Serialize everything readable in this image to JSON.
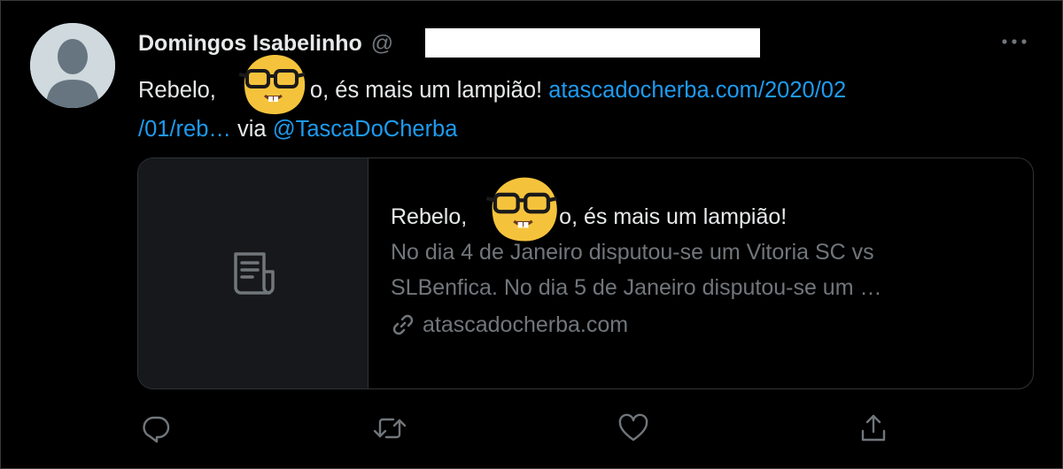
{
  "tweet": {
    "author_name": "Domingos Isabelinho",
    "handle_prefix": "@",
    "text_line1_a": "Rebelo,",
    "text_line1_b": "o, és mais um lampião!",
    "link_line1": "atascadocherba.com/2020/02",
    "link_line2": "/01/reb…",
    "via_text": "via",
    "mention": "@TascaDoCherba"
  },
  "card": {
    "title_a": "Rebelo,",
    "title_b": "o, és mais um lampião!",
    "description_line1": "No dia 4 de Janeiro disputou-se um Vitoria SC vs",
    "description_line2": "SLBenfica. No dia 5 de Janeiro disputou-se um …",
    "domain": "atascadocherba.com"
  },
  "icons": {
    "more": "more-horizontal-icon",
    "reply": "reply-icon",
    "retweet": "retweet-icon",
    "like": "heart-icon",
    "share": "share-icon",
    "card_placeholder": "document-icon",
    "link": "link-icon",
    "emoji": "nerd-face-emoji"
  },
  "colors": {
    "background": "#000000",
    "text_primary": "#e7e9ea",
    "text_secondary": "#71767b",
    "link": "#1d9bf0",
    "border": "#2f3336",
    "emoji": "#f5c33b"
  }
}
